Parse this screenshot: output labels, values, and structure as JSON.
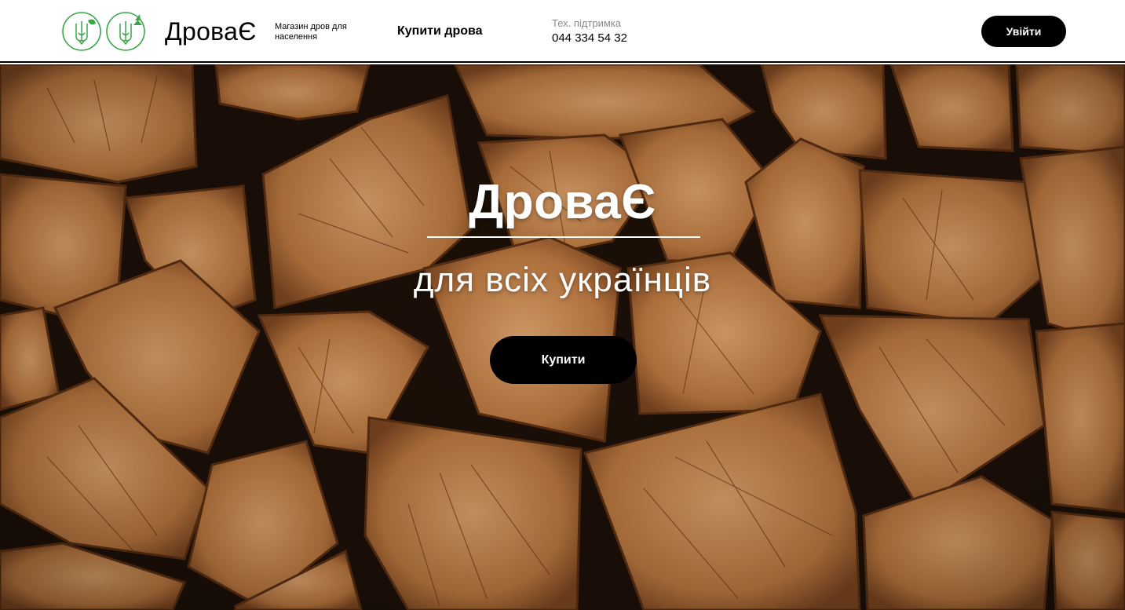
{
  "header": {
    "brand_name": "ДроваЄ",
    "brand_tagline": "Магазин дров для населення",
    "nav": {
      "buy_wood": "Купити дрова"
    },
    "support": {
      "label": "Тех. підтримка",
      "phone": "044 334 54 32"
    },
    "login_label": "Увійти"
  },
  "hero": {
    "title": "ДроваЄ",
    "subtitle": "для всіх українців",
    "buy_label": "Купити"
  },
  "icons": {
    "emblem_left": "trident-leaf-emblem-icon",
    "emblem_right": "trident-tree-emblem-icon"
  },
  "colors": {
    "header_bg": "#ffffff",
    "header_border": "#000000",
    "button_bg": "#000000",
    "button_text": "#ffffff",
    "emblem_green": "#3aa64a",
    "support_label": "#8a8a8a",
    "wood_light": "#c98a55",
    "wood_dark": "#7a4520"
  }
}
